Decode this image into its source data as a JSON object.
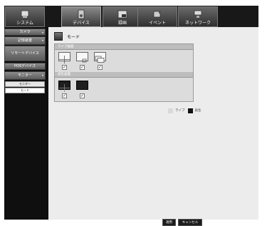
{
  "tabs": [
    {
      "label": "システム",
      "icon": "system-icon"
    },
    {
      "label": "デバイス",
      "icon": "device-icon"
    },
    {
      "label": "録画",
      "icon": "record-icon"
    },
    {
      "label": "イベント",
      "icon": "event-icon"
    },
    {
      "label": "ネットワーク",
      "icon": "network-icon"
    }
  ],
  "sidebar": {
    "items": [
      {
        "label": "カメラ"
      },
      {
        "label": "記憶装置"
      },
      {
        "label": "リモートデバイス"
      },
      {
        "label": "POSデバイス"
      },
      {
        "label": "モニター"
      }
    ],
    "subitems": [
      {
        "label": "モニター"
      },
      {
        "label": "モード"
      }
    ]
  },
  "page": {
    "title": "モード"
  },
  "live_section": {
    "label": "ライブ画面"
  },
  "playback_section": {
    "label": "再生画面"
  },
  "legend": {
    "live": "ライブ",
    "playback": "再生"
  },
  "buttons": {
    "apply": "適用",
    "cancel": "キャンセル"
  },
  "colors": {
    "frame": "#101010",
    "content_bg": "#ececec",
    "panel_bg": "#dcdcdc",
    "section_header": "#bdbdbd",
    "legend_live": "#d9d9d9",
    "legend_playback": "#111111"
  }
}
